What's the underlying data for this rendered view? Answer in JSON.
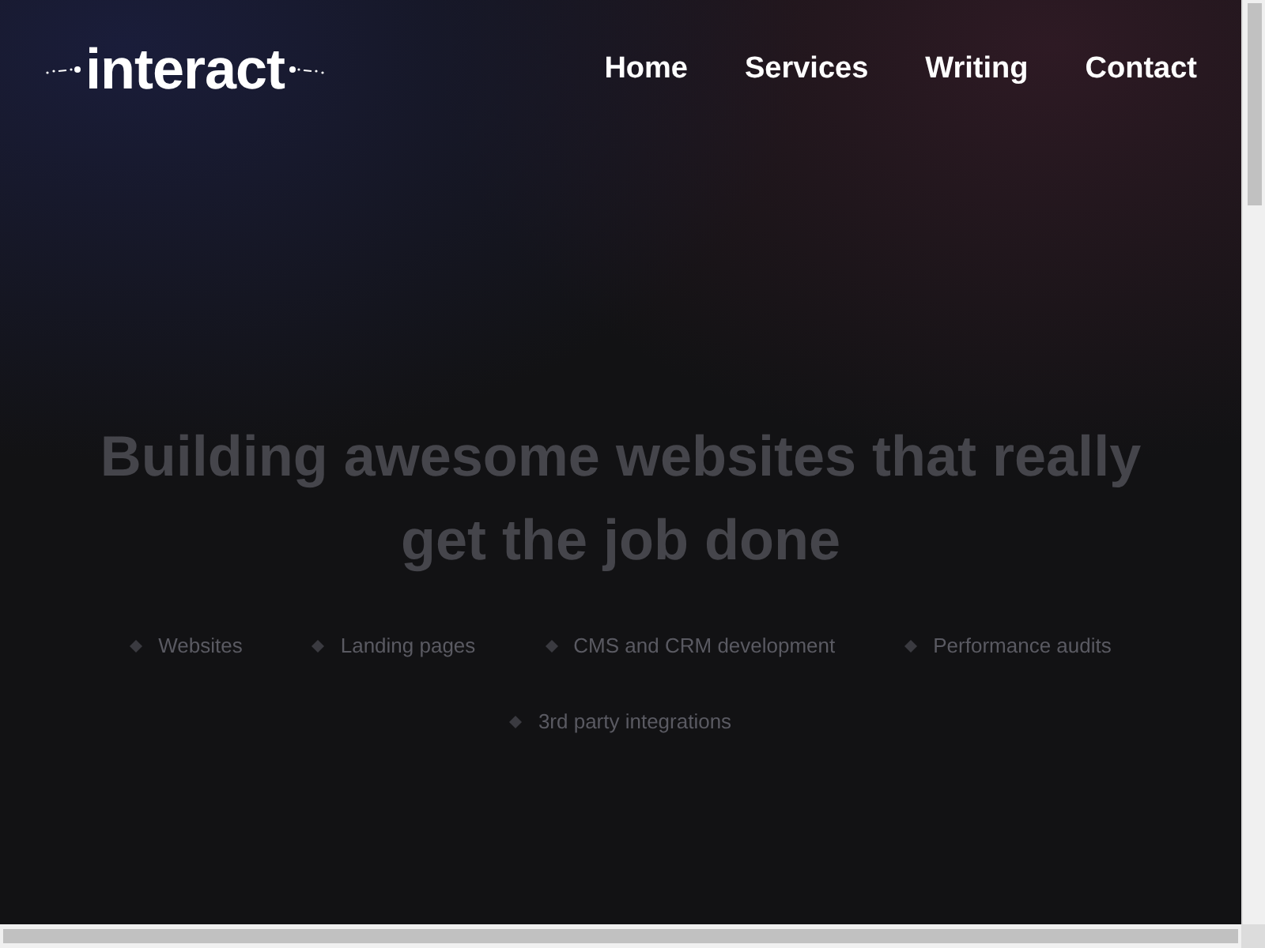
{
  "logo": "interact",
  "nav": [
    {
      "label": "Home"
    },
    {
      "label": "Services"
    },
    {
      "label": "Writing"
    },
    {
      "label": "Contact"
    }
  ],
  "hero": {
    "heading": "Building awesome websites that really get the job done",
    "services": [
      {
        "label": "Websites"
      },
      {
        "label": "Landing pages"
      },
      {
        "label": "CMS and CRM development"
      },
      {
        "label": "Performance audits"
      },
      {
        "label": "3rd party integrations"
      }
    ]
  }
}
